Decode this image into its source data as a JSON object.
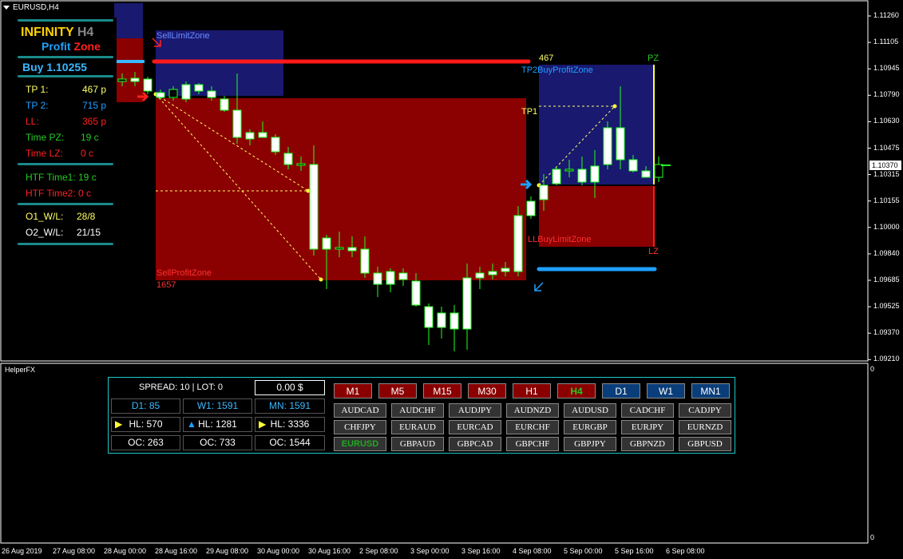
{
  "window": {
    "symbol_title": "EURUSD,H4",
    "subwindow_title": "HelperFX"
  },
  "colors": {
    "sell_zone": "#8b0000",
    "buy_zone": "#191970",
    "bull_candle": "#ffffff",
    "wick": "#00ff00",
    "accent_teal": "#1a8a8a",
    "tp_line": "#1ea0ff"
  },
  "panel": {
    "brand_infinity": "INFINITY",
    "brand_h4": "H4",
    "brand_profit": "Profit",
    "brand_zone": "Zone",
    "signal": "Buy 1.10255",
    "rows": [
      {
        "label": "TP 1:",
        "value": "467 p",
        "color": "#ffff66"
      },
      {
        "label": "TP 2:",
        "value": "715 p",
        "color": "#1ea0ff"
      },
      {
        "label": "LL:",
        "value": "365 p",
        "color": "#ff2020"
      },
      {
        "label": "Time PZ:",
        "value": "19 c",
        "color": "#22cc22"
      },
      {
        "label": "Time LZ:",
        "value": "0 c",
        "color": "#ff2020"
      }
    ],
    "htf_rows": [
      {
        "label": "HTF Time1: 19 c",
        "color": "#22cc22"
      },
      {
        "label": "HTF Time2: 0 c",
        "color": "#ff2020"
      }
    ],
    "wl_rows": [
      {
        "label": "O1_W/L:",
        "value": "28/8",
        "color": "#ffff66"
      },
      {
        "label": "O2_W/L:",
        "value": "21/15",
        "color": "#ffffff"
      }
    ]
  },
  "zones": {
    "sell_limit": "SellLimitZone",
    "sell_profit": "SellProfitZone",
    "sell_profit_value": "1657",
    "tp2_buy": "TP2BuyProfitZone",
    "tp_value": "467",
    "pz": "PZ",
    "tp1": "TP1",
    "ll_buy": "LLBuyLimitZone",
    "lz": "LZ"
  },
  "price_axis": {
    "labels": [
      "1.11260",
      "1.11105",
      "1.10945",
      "1.10790",
      "1.10630",
      "1.10475",
      "1.10315",
      "1.10155",
      "1.10000",
      "1.09840",
      "1.09685",
      "1.09525",
      "1.09370",
      "1.09210"
    ],
    "current_price": "1.10370"
  },
  "time_axis": [
    "26 Aug 2019",
    "27 Aug 08:00",
    "28 Aug 00:00",
    "28 Aug 16:00",
    "29 Aug 08:00",
    "30 Aug 00:00",
    "30 Aug 16:00",
    "2 Sep 08:00",
    "3 Sep 00:00",
    "3 Sep 16:00",
    "4 Sep 08:00",
    "5 Sep 00:00",
    "5 Sep 16:00",
    "6 Sep 08:00"
  ],
  "subwindow_axis": {
    "top": "0",
    "bottom": "0"
  },
  "helper": {
    "spread_lot": "SPREAD: 10  |  LOT: 0",
    "balance": "0.00 $",
    "d1": "D1: 85",
    "w1": "W1: 1591",
    "mn": "MN: 1591",
    "hl1": "HL: 570",
    "hl2": "HL: 1281",
    "hl3": "HL: 3336",
    "oc1": "OC: 263",
    "oc2": "OC: 733",
    "oc3": "OC: 1544",
    "timeframes": [
      "M1",
      "M5",
      "M15",
      "M30",
      "H1",
      "H4",
      "D1",
      "W1",
      "MN1"
    ],
    "active_timeframe": "H4",
    "pairs": [
      "AUDCAD",
      "AUDCHF",
      "AUDJPY",
      "AUDNZD",
      "AUDUSD",
      "CADCHF",
      "CADJPY",
      "CHFJPY",
      "EURAUD",
      "EURCAD",
      "EURCHF",
      "EURGBP",
      "EURJPY",
      "EURNZD",
      "EURUSD",
      "GBPAUD",
      "GBPCAD",
      "GBPCHF",
      "GBPJPY",
      "GBPNZD",
      "GBPUSD"
    ],
    "active_pair": "EURUSD"
  }
}
